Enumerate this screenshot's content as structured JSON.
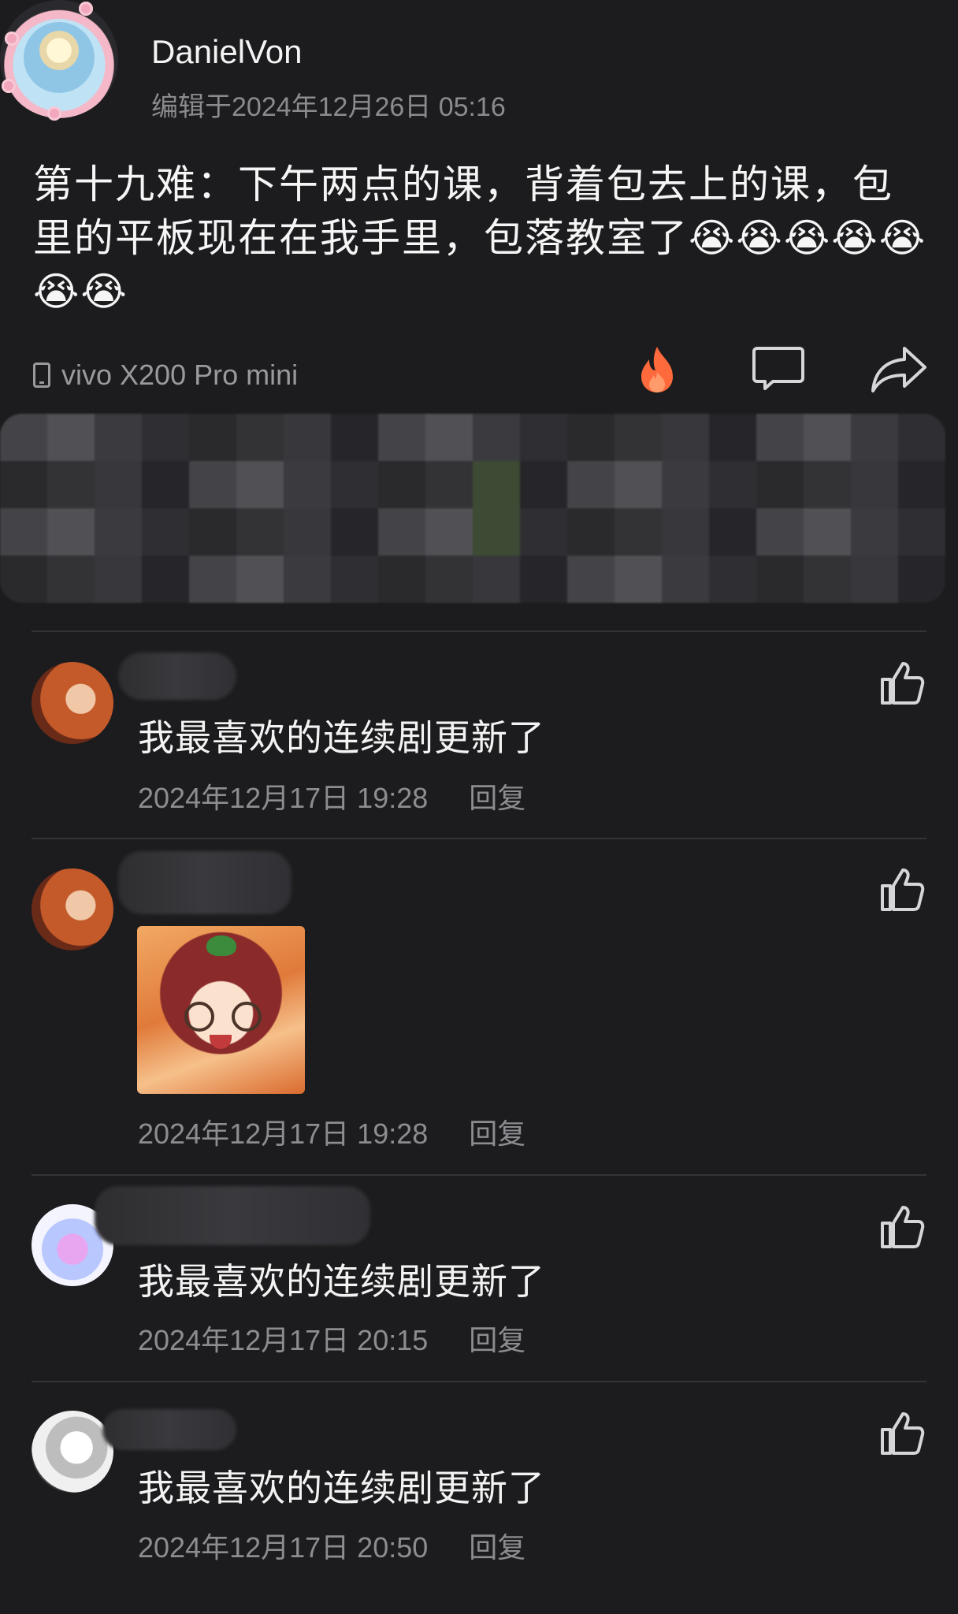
{
  "post": {
    "author": "DanielVon",
    "edit_time": "编辑于2024年12月26日 05:16",
    "text": "第十九难：下午两点的课，背着包去上的课，包里的平板现在在我手里，包落教室了😭😭😭😭😭😭😭",
    "device": "vivo X200 Pro mini"
  },
  "icons": {
    "device": "phone-icon",
    "hot": "fire-icon",
    "comment": "comment-icon",
    "share": "share-icon",
    "like": "thumbs-up-icon"
  },
  "colors": {
    "background": "#1c1c1e",
    "primary_text": "#f2f2f2",
    "secondary_text": "#8d8d91",
    "fire": "#ff6a3d"
  },
  "comments": [
    {
      "text": "我最喜欢的连续剧更新了",
      "time": "2024年12月17日 19:28",
      "reply": "回复"
    },
    {
      "text": "",
      "time": "2024年12月17日 19:28",
      "reply": "回复",
      "has_sticker": true
    },
    {
      "text": "我最喜欢的连续剧更新了",
      "time": "2024年12月17日 20:15",
      "reply": "回复"
    },
    {
      "text": "我最喜欢的连续剧更新了",
      "time": "2024年12月17日 20:50",
      "reply": "回复"
    }
  ]
}
